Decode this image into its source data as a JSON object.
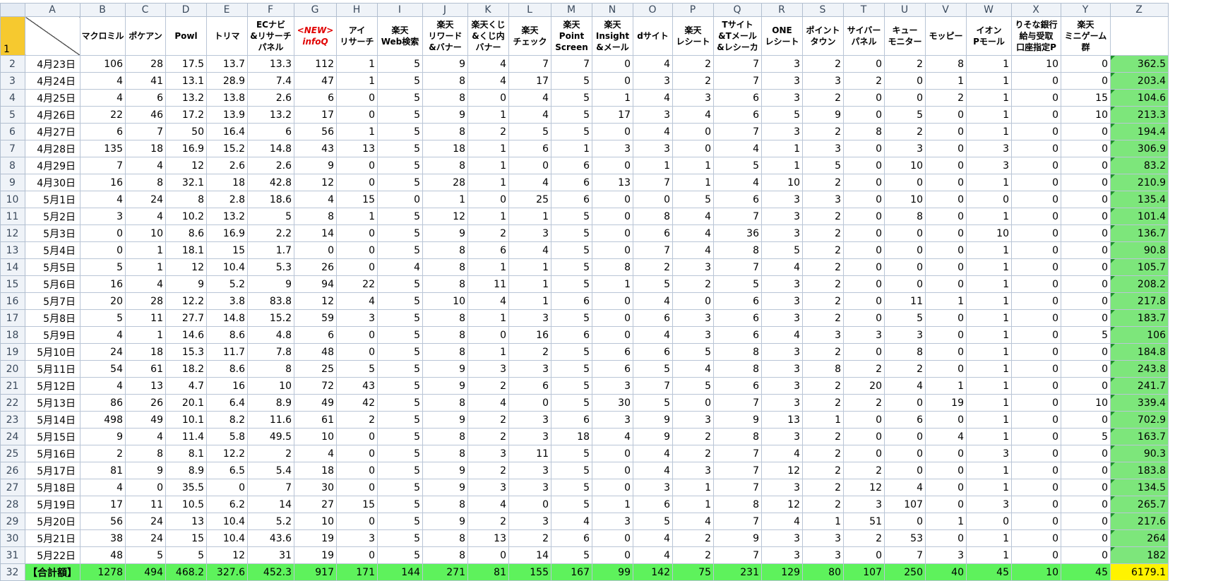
{
  "column_letters": [
    "A",
    "B",
    "C",
    "D",
    "E",
    "F",
    "G",
    "H",
    "I",
    "J",
    "K",
    "L",
    "M",
    "N",
    "O",
    "P",
    "Q",
    "R",
    "S",
    "T",
    "U",
    "V",
    "W",
    "X",
    "Y",
    "Z"
  ],
  "headers": [
    "",
    "マクロミル",
    "ポケアン",
    "Powl",
    "トリマ",
    "ECナビ\n&リサーチ\nパネル",
    "<NEW>\ninfoQ",
    "アイ\nリサーチ",
    "楽天\nWeb検索",
    "楽天\nリワード\n&バナー",
    "楽天くじ\n&くじ内\nバナー",
    "楽天\nチェック",
    "楽天\nPoint\nScreen",
    "楽天\nInsight\n&メール",
    "dサイト",
    "楽天\nレシート",
    "Tサイト\n&Tメール\n&レシーカ",
    "ONE\nレシート",
    "ポイント\nタウン",
    "サイバー\nパネル",
    "キュー\nモニター",
    "モッピー",
    "イオン\nPモール",
    "りそな銀行\n給与受取\n口座指定P",
    "楽天\nミニゲーム\n群",
    ""
  ],
  "rows": [
    [
      "4月23日",
      "106",
      "28",
      "17.5",
      "13.7",
      "13.3",
      "112",
      "1",
      "5",
      "9",
      "4",
      "7",
      "7",
      "0",
      "4",
      "2",
      "7",
      "3",
      "2",
      "0",
      "2",
      "8",
      "1",
      "10",
      "0",
      "362.5"
    ],
    [
      "4月24日",
      "4",
      "41",
      "13.1",
      "28.9",
      "7.4",
      "47",
      "1",
      "5",
      "8",
      "4",
      "17",
      "5",
      "0",
      "3",
      "2",
      "7",
      "3",
      "3",
      "2",
      "0",
      "1",
      "1",
      "0",
      "0",
      "203.4"
    ],
    [
      "4月25日",
      "4",
      "6",
      "13.2",
      "13.8",
      "2.6",
      "6",
      "0",
      "5",
      "8",
      "0",
      "4",
      "5",
      "1",
      "4",
      "3",
      "6",
      "3",
      "2",
      "0",
      "0",
      "2",
      "1",
      "0",
      "15",
      "104.6"
    ],
    [
      "4月26日",
      "22",
      "46",
      "17.2",
      "13.9",
      "13.2",
      "17",
      "0",
      "5",
      "9",
      "1",
      "4",
      "5",
      "17",
      "3",
      "4",
      "6",
      "5",
      "9",
      "0",
      "5",
      "0",
      "1",
      "0",
      "10",
      "213.3"
    ],
    [
      "4月27日",
      "6",
      "7",
      "50",
      "16.4",
      "6",
      "56",
      "1",
      "5",
      "8",
      "2",
      "5",
      "5",
      "0",
      "4",
      "0",
      "7",
      "3",
      "2",
      "8",
      "2",
      "0",
      "1",
      "0",
      "0",
      "194.4"
    ],
    [
      "4月28日",
      "135",
      "18",
      "16.9",
      "15.2",
      "14.8",
      "43",
      "13",
      "5",
      "18",
      "1",
      "6",
      "1",
      "3",
      "3",
      "0",
      "4",
      "1",
      "3",
      "0",
      "3",
      "0",
      "3",
      "0",
      "0",
      "306.9"
    ],
    [
      "4月29日",
      "7",
      "4",
      "12",
      "2.6",
      "2.6",
      "9",
      "0",
      "5",
      "8",
      "1",
      "0",
      "6",
      "0",
      "1",
      "1",
      "5",
      "1",
      "5",
      "0",
      "10",
      "0",
      "3",
      "0",
      "0",
      "83.2"
    ],
    [
      "4月30日",
      "16",
      "8",
      "32.1",
      "18",
      "42.8",
      "12",
      "0",
      "5",
      "28",
      "1",
      "4",
      "6",
      "13",
      "7",
      "1",
      "4",
      "10",
      "2",
      "0",
      "0",
      "0",
      "1",
      "0",
      "0",
      "210.9"
    ],
    [
      "5月1日",
      "4",
      "24",
      "8",
      "2.8",
      "18.6",
      "4",
      "15",
      "0",
      "1",
      "0",
      "25",
      "6",
      "0",
      "0",
      "5",
      "6",
      "3",
      "3",
      "0",
      "10",
      "0",
      "0",
      "0",
      "0",
      "135.4"
    ],
    [
      "5月2日",
      "3",
      "4",
      "10.2",
      "13.2",
      "5",
      "8",
      "1",
      "5",
      "12",
      "1",
      "1",
      "5",
      "0",
      "8",
      "4",
      "7",
      "3",
      "2",
      "0",
      "8",
      "0",
      "1",
      "0",
      "0",
      "101.4"
    ],
    [
      "5月3日",
      "0",
      "10",
      "8.6",
      "16.9",
      "2.2",
      "14",
      "0",
      "5",
      "9",
      "2",
      "3",
      "5",
      "0",
      "6",
      "4",
      "36",
      "3",
      "2",
      "0",
      "0",
      "0",
      "10",
      "0",
      "0",
      "136.7"
    ],
    [
      "5月4日",
      "0",
      "1",
      "18.1",
      "15",
      "1.7",
      "0",
      "0",
      "5",
      "8",
      "6",
      "4",
      "5",
      "0",
      "7",
      "4",
      "8",
      "5",
      "2",
      "0",
      "0",
      "0",
      "1",
      "0",
      "0",
      "90.8"
    ],
    [
      "5月5日",
      "5",
      "1",
      "12",
      "10.4",
      "5.3",
      "26",
      "0",
      "4",
      "8",
      "1",
      "1",
      "5",
      "8",
      "2",
      "3",
      "7",
      "4",
      "2",
      "0",
      "0",
      "0",
      "1",
      "0",
      "0",
      "105.7"
    ],
    [
      "5月6日",
      "16",
      "4",
      "9",
      "5.2",
      "9",
      "94",
      "22",
      "5",
      "8",
      "11",
      "1",
      "5",
      "1",
      "5",
      "2",
      "5",
      "3",
      "2",
      "0",
      "0",
      "0",
      "1",
      "0",
      "0",
      "208.2"
    ],
    [
      "5月7日",
      "20",
      "28",
      "12.2",
      "3.8",
      "83.8",
      "12",
      "4",
      "5",
      "10",
      "4",
      "1",
      "6",
      "0",
      "4",
      "0",
      "6",
      "3",
      "2",
      "0",
      "11",
      "1",
      "1",
      "0",
      "0",
      "217.8"
    ],
    [
      "5月8日",
      "5",
      "11",
      "27.7",
      "14.8",
      "15.2",
      "59",
      "3",
      "5",
      "8",
      "1",
      "3",
      "5",
      "0",
      "6",
      "3",
      "6",
      "3",
      "2",
      "0",
      "5",
      "0",
      "1",
      "0",
      "0",
      "183.7"
    ],
    [
      "5月9日",
      "4",
      "1",
      "14.6",
      "8.6",
      "4.8",
      "6",
      "0",
      "5",
      "8",
      "0",
      "16",
      "6",
      "0",
      "4",
      "3",
      "6",
      "4",
      "3",
      "3",
      "3",
      "0",
      "1",
      "0",
      "5",
      "106"
    ],
    [
      "5月10日",
      "24",
      "18",
      "15.3",
      "11.7",
      "7.8",
      "48",
      "0",
      "5",
      "8",
      "1",
      "2",
      "5",
      "6",
      "6",
      "5",
      "8",
      "3",
      "2",
      "0",
      "8",
      "0",
      "1",
      "0",
      "0",
      "184.8"
    ],
    [
      "5月11日",
      "54",
      "61",
      "18.2",
      "8.6",
      "8",
      "25",
      "5",
      "5",
      "9",
      "3",
      "3",
      "5",
      "6",
      "5",
      "4",
      "8",
      "3",
      "8",
      "2",
      "2",
      "0",
      "1",
      "0",
      "0",
      "243.8"
    ],
    [
      "5月12日",
      "4",
      "13",
      "4.7",
      "16",
      "10",
      "72",
      "43",
      "5",
      "9",
      "2",
      "6",
      "5",
      "3",
      "7",
      "5",
      "6",
      "3",
      "2",
      "20",
      "4",
      "1",
      "1",
      "0",
      "0",
      "241.7"
    ],
    [
      "5月13日",
      "86",
      "26",
      "20.1",
      "6.4",
      "8.9",
      "49",
      "42",
      "5",
      "8",
      "4",
      "0",
      "5",
      "30",
      "5",
      "0",
      "7",
      "3",
      "2",
      "2",
      "0",
      "19",
      "1",
      "0",
      "10",
      "339.4"
    ],
    [
      "5月14日",
      "498",
      "49",
      "10.1",
      "8.2",
      "11.6",
      "61",
      "2",
      "5",
      "9",
      "2",
      "3",
      "6",
      "3",
      "9",
      "3",
      "9",
      "13",
      "1",
      "0",
      "6",
      "0",
      "1",
      "0",
      "0",
      "702.9"
    ],
    [
      "5月15日",
      "9",
      "4",
      "11.4",
      "5.8",
      "49.5",
      "10",
      "0",
      "5",
      "8",
      "2",
      "3",
      "18",
      "4",
      "9",
      "2",
      "8",
      "3",
      "2",
      "0",
      "0",
      "4",
      "1",
      "0",
      "5",
      "163.7"
    ],
    [
      "5月16日",
      "2",
      "8",
      "8.1",
      "12.2",
      "2",
      "4",
      "0",
      "5",
      "8",
      "3",
      "11",
      "5",
      "0",
      "4",
      "2",
      "7",
      "4",
      "2",
      "0",
      "0",
      "0",
      "3",
      "0",
      "0",
      "90.3"
    ],
    [
      "5月17日",
      "81",
      "9",
      "8.9",
      "6.5",
      "5.4",
      "18",
      "0",
      "5",
      "9",
      "2",
      "3",
      "5",
      "0",
      "4",
      "3",
      "7",
      "12",
      "2",
      "2",
      "0",
      "0",
      "1",
      "0",
      "0",
      "183.8"
    ],
    [
      "5月18日",
      "4",
      "0",
      "35.5",
      "0",
      "7",
      "30",
      "0",
      "5",
      "9",
      "3",
      "3",
      "5",
      "0",
      "3",
      "1",
      "7",
      "3",
      "2",
      "12",
      "4",
      "0",
      "1",
      "0",
      "0",
      "134.5"
    ],
    [
      "5月19日",
      "17",
      "11",
      "10.5",
      "6.2",
      "14",
      "27",
      "15",
      "5",
      "8",
      "4",
      "0",
      "5",
      "1",
      "6",
      "1",
      "8",
      "12",
      "2",
      "3",
      "107",
      "0",
      "3",
      "0",
      "0",
      "265.7"
    ],
    [
      "5月20日",
      "56",
      "24",
      "13",
      "10.4",
      "5.2",
      "10",
      "0",
      "5",
      "9",
      "2",
      "3",
      "4",
      "3",
      "5",
      "4",
      "7",
      "4",
      "1",
      "51",
      "0",
      "1",
      "0",
      "0",
      "0",
      "217.6"
    ],
    [
      "5月21日",
      "38",
      "24",
      "15",
      "10.4",
      "43.6",
      "19",
      "3",
      "5",
      "8",
      "13",
      "2",
      "6",
      "0",
      "4",
      "2",
      "9",
      "3",
      "3",
      "2",
      "53",
      "0",
      "1",
      "0",
      "0",
      "264"
    ],
    [
      "5月22日",
      "48",
      "5",
      "5",
      "12",
      "31",
      "19",
      "0",
      "5",
      "8",
      "0",
      "14",
      "5",
      "0",
      "4",
      "2",
      "7",
      "3",
      "3",
      "0",
      "7",
      "3",
      "1",
      "0",
      "0",
      "182"
    ]
  ],
  "total_row": [
    "【合計額】",
    "1278",
    "494",
    "468.2",
    "327.6",
    "452.3",
    "917",
    "171",
    "144",
    "271",
    "81",
    "155",
    "167",
    "99",
    "142",
    "75",
    "231",
    "129",
    "80",
    "107",
    "250",
    "40",
    "45",
    "10",
    "45",
    "6179.1"
  ],
  "colors": {
    "header_yellow": "#f6c92f",
    "total_green": "#5ef25c",
    "sum_green": "#7de67b",
    "grand_total_yellow": "#fff300",
    "new_red": "#e00000"
  }
}
